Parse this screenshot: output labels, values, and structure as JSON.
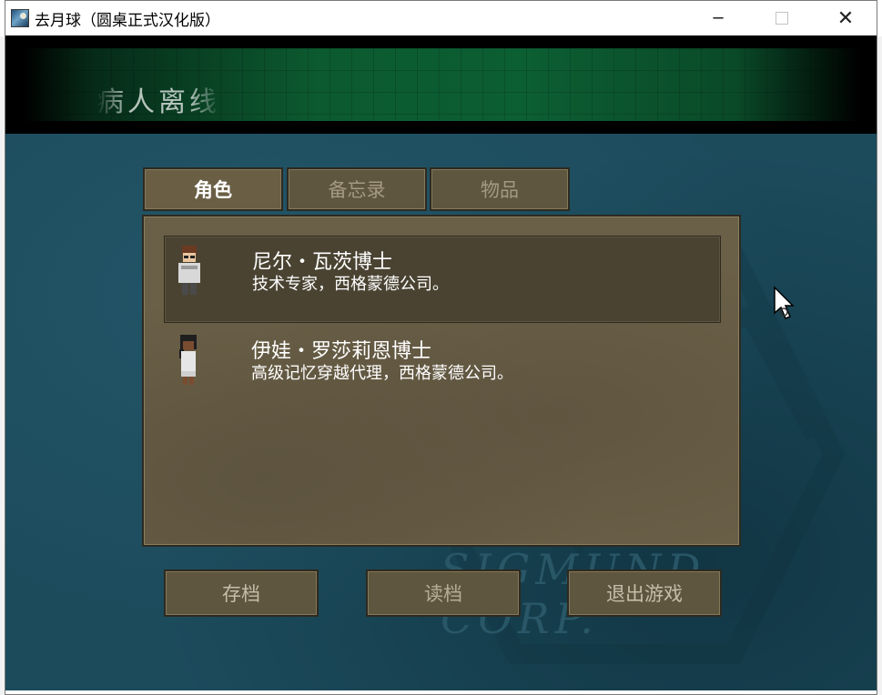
{
  "window": {
    "title": "去月球（圆桌正式汉化版）",
    "minimize_glyph": "─",
    "close_glyph": "✕"
  },
  "banner": {
    "text": "病人离线"
  },
  "tabs": [
    {
      "label": "角色",
      "active": true
    },
    {
      "label": "备忘录",
      "active": false
    },
    {
      "label": "物品",
      "active": false
    }
  ],
  "characters": [
    {
      "name": "尼尔・瓦茨博士",
      "description": "技术专家，西格蒙德公司。",
      "selected": true
    },
    {
      "name": "伊娃・罗莎莉恩博士",
      "description": "高级记忆穿越代理，西格蒙德公司。",
      "selected": false
    }
  ],
  "buttons": {
    "save": "存档",
    "load": "读档",
    "quit": "退出游戏"
  },
  "watermark": {
    "text": "SIGMUND  CORP."
  },
  "colors": {
    "game_bg": "#1c4b5c",
    "panel_bg": "#6a5f47",
    "button_bg": "#5f5640",
    "banner_green": "#0c5a30"
  }
}
